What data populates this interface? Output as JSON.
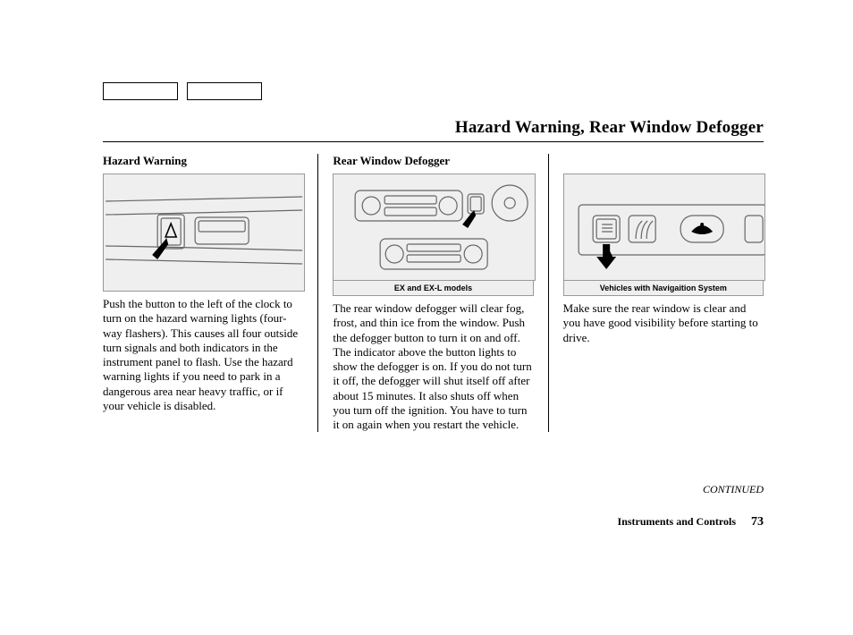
{
  "title": "Hazard Warning, Rear Window Defogger",
  "col1": {
    "heading": "Hazard Warning",
    "body": "Push the button to the left of the clock to turn on the hazard warning lights (four-way flashers). This causes all four outside turn signals and both indicators in the instrument panel to flash. Use the hazard warning lights if you need to park in a dangerous area near heavy traffic, or if your vehicle is disabled."
  },
  "col2": {
    "heading": "Rear Window Defogger",
    "caption": "EX and EX-L models",
    "body": "The rear window defogger will clear fog, frost, and thin ice from the window. Push the defogger button to turn it on and off. The indicator above the button lights to show the defogger is on. If you do not turn it off, the defogger will shut itself off after about 15 minutes. It also shuts off when you turn off the ignition. You have to turn it on again when you restart the vehicle."
  },
  "col3": {
    "caption": "Vehicles with Navigaition System",
    "body": "Make sure the rear window is clear and you have good visibility before starting to drive."
  },
  "continued": "CONTINUED",
  "footer_section": "Instruments and Controls",
  "page_number": "73"
}
